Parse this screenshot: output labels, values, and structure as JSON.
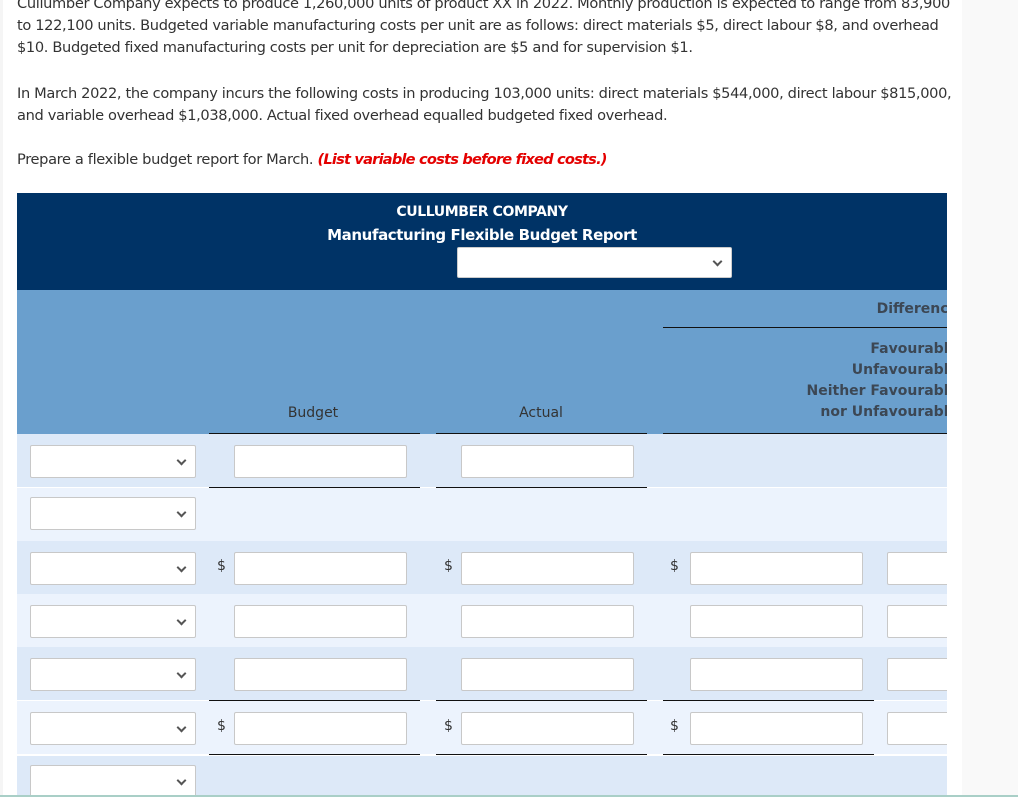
{
  "question": {
    "paragraph1": "Cullumber Company expects to produce 1,260,000 units of product XX in 2022. Monthly production is expected to range from 83,900 to 122,100 units. Budgeted variable manufacturing costs per unit are as follows: direct materials $5, direct labour $8, and overhead $10. Budgeted fixed manufacturing costs per unit for depreciation are $5 and for supervision $1.",
    "paragraph2": "In March 2022, the company incurs the following costs in producing 103,000 units: direct materials $544,000, direct labour $815,000, and variable overhead $1,038,000. Actual fixed overhead equalled budgeted fixed overhead.",
    "instruction": "Prepare a flexible budget report for March.",
    "instruction_note": "(List variable costs before fixed costs.)"
  },
  "report": {
    "company_name": "CULLUMBER COMPANY",
    "report_title": "Manufacturing Flexible Budget Report",
    "period_select_value": "",
    "columns": {
      "budget": "Budget",
      "actual": "Actual",
      "difference": "Difference",
      "difference_options_label_1": "Favourable",
      "difference_options_label_2": "Unfavourable",
      "difference_options_label_3": "Neither Favourable",
      "difference_options_label_4": "nor Unfavourable"
    },
    "currency_symbol": "$",
    "rows": [
      {
        "label_value": "",
        "budget": "",
        "actual": "",
        "difference": "",
        "status": ""
      },
      {
        "label_value": ""
      },
      {
        "label_value": "",
        "budget": "",
        "actual": "",
        "difference": "",
        "status": ""
      },
      {
        "label_value": "",
        "budget": "",
        "actual": "",
        "difference": "",
        "status": ""
      },
      {
        "label_value": "",
        "budget": "",
        "actual": "",
        "difference": "",
        "status": ""
      },
      {
        "label_value": "",
        "budget": "",
        "actual": "",
        "difference": "",
        "status": ""
      },
      {
        "label_value": ""
      }
    ]
  },
  "colors": {
    "header_dark": "#003366",
    "header_light": "#6a9fcd",
    "row_even": "#dde9f8",
    "row_odd": "#ecf3fd",
    "instruction_red": "#e40000"
  }
}
